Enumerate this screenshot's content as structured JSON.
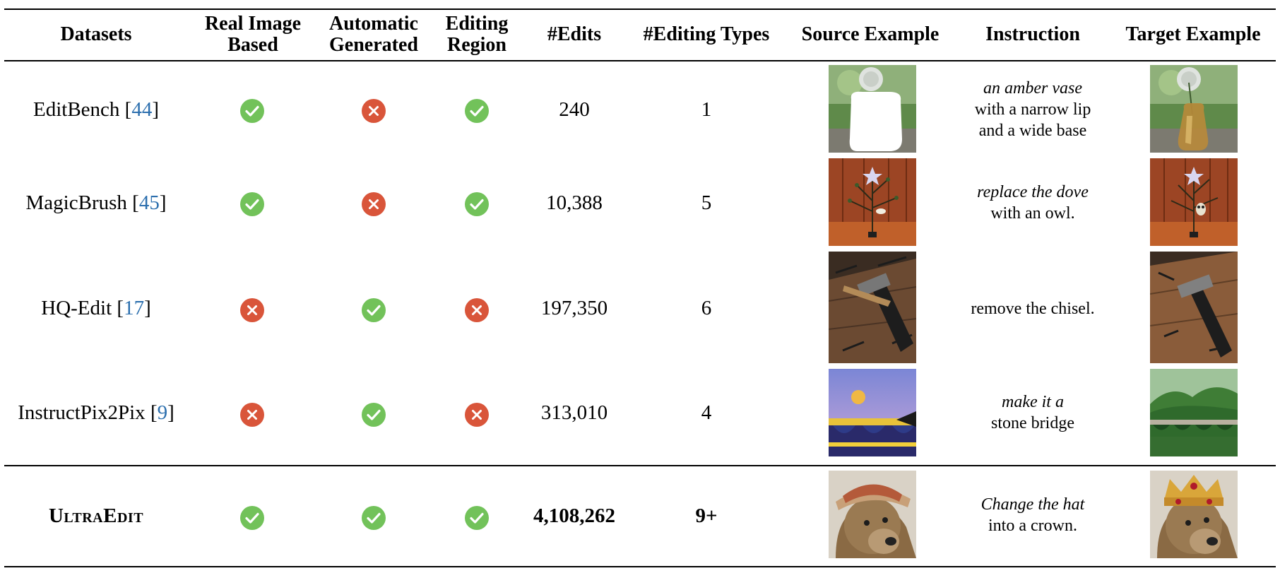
{
  "headers": {
    "datasets": "Datasets",
    "real_image_based": [
      "Real Image",
      "Based"
    ],
    "automatic_generated": [
      "Automatic",
      "Generated"
    ],
    "editing_region": [
      "Editing",
      "Region"
    ],
    "edits": "#Edits",
    "editing_types": "#Editing Types",
    "source_example": "Source Example",
    "instruction": "Instruction",
    "target_example": "Target Example"
  },
  "colors": {
    "check": "#72c25a",
    "cross": "#d9553a",
    "link": "#2c6fae"
  },
  "icons": {
    "yes": "check-circle-icon",
    "no": "cross-circle-icon"
  },
  "rows": [
    {
      "name": "EditBench",
      "ref": "44",
      "real": "yes",
      "auto": "no",
      "region": "yes",
      "edits": "240",
      "types": "1",
      "instruction": {
        "italic": "an amber vase",
        "rest": [
          "with a narrow lip",
          "and a wide base"
        ]
      }
    },
    {
      "name": "MagicBrush",
      "ref": "45",
      "real": "yes",
      "auto": "no",
      "region": "yes",
      "edits": "10,388",
      "types": "5",
      "instruction": {
        "italic": "replace the dove",
        "rest": [
          "with an owl."
        ]
      }
    },
    {
      "name": "HQ-Edit",
      "ref": "17",
      "real": "no",
      "auto": "yes",
      "region": "no",
      "edits": "197,350",
      "types": "6",
      "instruction": {
        "italic": "",
        "rest": [
          "remove the chisel."
        ]
      }
    },
    {
      "name": "InstructPix2Pix",
      "ref": "9",
      "real": "no",
      "auto": "yes",
      "region": "no",
      "edits": "313,010",
      "types": "4",
      "instruction": {
        "italic": "make it a",
        "rest": [
          "stone bridge"
        ]
      }
    },
    {
      "name": "UltraEdit",
      "ref": "",
      "real": "yes",
      "auto": "yes",
      "region": "yes",
      "edits": "4,108,262",
      "types": "9+",
      "instruction": {
        "italic": "Change the hat",
        "rest": [
          "into a crown."
        ]
      }
    }
  ]
}
